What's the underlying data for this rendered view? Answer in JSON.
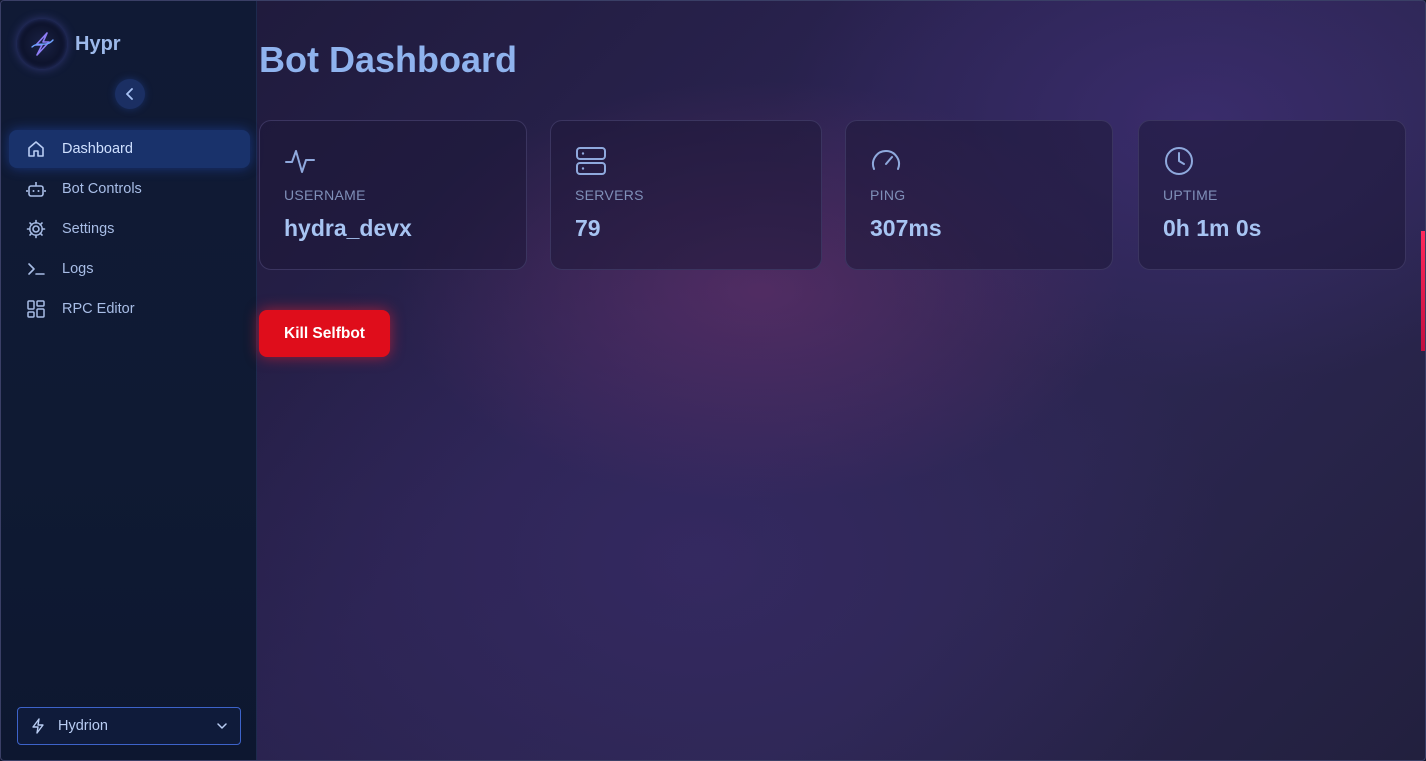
{
  "app": {
    "name": "Hypr"
  },
  "sidebar": {
    "collapse_icon": "chevron-left-icon",
    "items": [
      {
        "label": "Dashboard",
        "icon": "home-icon",
        "active": true
      },
      {
        "label": "Bot Controls",
        "icon": "bot-icon",
        "active": false
      },
      {
        "label": "Settings",
        "icon": "gear-icon",
        "active": false
      },
      {
        "label": "Logs",
        "icon": "terminal-icon",
        "active": false
      },
      {
        "label": "RPC Editor",
        "icon": "layout-grid-icon",
        "active": false
      }
    ],
    "selector": {
      "value": "Hydrion",
      "icon": "lightning-icon"
    }
  },
  "main": {
    "title": "Bot Dashboard",
    "stats": [
      {
        "label": "USERNAME",
        "value": "hydra_devx",
        "icon": "activity-icon"
      },
      {
        "label": "SERVERS",
        "value": "79",
        "icon": "server-icon"
      },
      {
        "label": "PING",
        "value": "307ms",
        "icon": "gauge-icon"
      },
      {
        "label": "UPTIME",
        "value": "0h 1m 0s",
        "icon": "clock-icon"
      }
    ],
    "kill_button": "Kill Selfbot"
  },
  "colors": {
    "accent": "#8fb3ee",
    "danger": "#df0d1b",
    "sidebar_bg": "#0f1a33",
    "active_item": "#19326b"
  }
}
